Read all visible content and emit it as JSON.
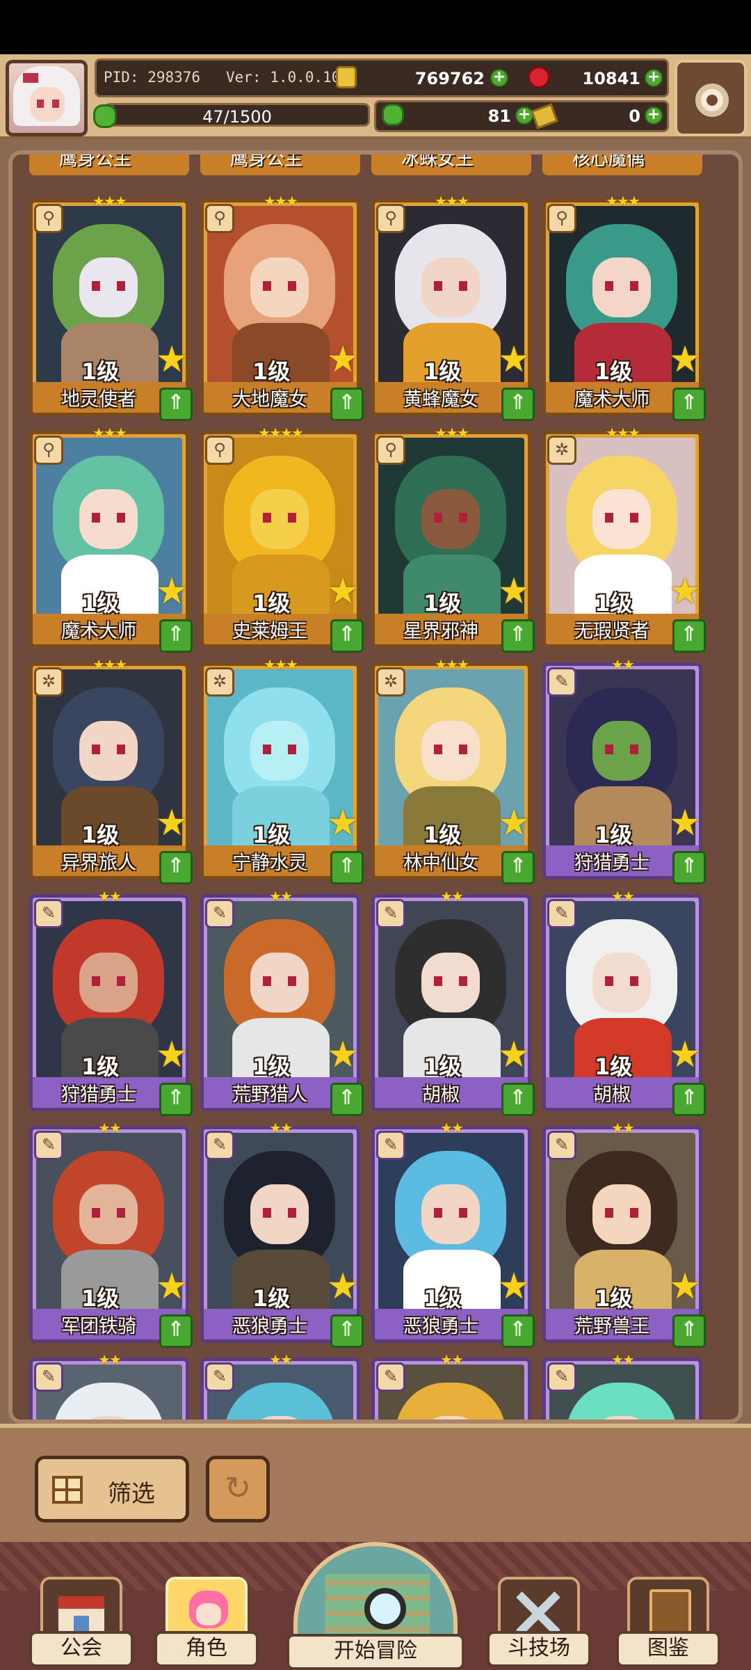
{
  "header": {
    "pid": "PID: 298376",
    "version": "Ver: 1.0.0.10",
    "gold": "769762",
    "gems": "10841",
    "xp_text": "47/1500",
    "xp_fraction": 0.0313,
    "clover": "81",
    "tickets": "0"
  },
  "partial_top": [
    "鹰身公主",
    "鹰身公主",
    "冰蛛女王",
    "核心魔偶"
  ],
  "cards": [
    {
      "name": "地灵使者",
      "level": "1级",
      "rarity": "gold",
      "stars": "★★★",
      "type_icon": "sword",
      "palette": [
        "#2d3a4a",
        "#6aa34a",
        "#e9e6ef",
        "#a98468"
      ]
    },
    {
      "name": "大地魔女",
      "level": "1级",
      "rarity": "gold",
      "stars": "★★★",
      "type_icon": "sword",
      "palette": [
        "#b5502e",
        "#e7a27a",
        "#f3d6bd",
        "#8a4a2a"
      ]
    },
    {
      "name": "黄蜂魔女",
      "level": "1级",
      "rarity": "gold",
      "stars": "★★★",
      "type_icon": "sword",
      "palette": [
        "#2b2b33",
        "#e7e4ec",
        "#f1d5c7",
        "#e3a02c"
      ]
    },
    {
      "name": "魔术大师",
      "level": "1级",
      "rarity": "gold",
      "stars": "★★★",
      "type_icon": "sword",
      "palette": [
        "#1f2a2e",
        "#3a9a8a",
        "#f3d6c8",
        "#b62b3a"
      ]
    },
    {
      "name": "魔术大师",
      "level": "1级",
      "rarity": "gold",
      "stars": "★★★",
      "type_icon": "sword",
      "palette": [
        "#4d7fa0",
        "#63c2a3",
        "#f6dccc",
        "#ffffff"
      ]
    },
    {
      "name": "史莱姆王",
      "level": "1级",
      "rarity": "gold",
      "stars": "★★★★",
      "type_icon": "sword",
      "palette": [
        "#c88a19",
        "#f0b81e",
        "#f6cf4a",
        "#d79a1e"
      ]
    },
    {
      "name": "星界邪神",
      "level": "1级",
      "rarity": "gold",
      "stars": "★★★",
      "type_icon": "sword",
      "palette": [
        "#1f3a36",
        "#2e6e55",
        "#8a5a3e",
        "#3f8a6a"
      ]
    },
    {
      "name": "无瑕贤者",
      "level": "1级",
      "rarity": "gold",
      "stars": "★★★",
      "type_icon": "shield",
      "palette": [
        "#d9c0c0",
        "#f6d565",
        "#fae3d3",
        "#ffffff"
      ]
    },
    {
      "name": "异界旅人",
      "level": "1级",
      "rarity": "gold",
      "stars": "★★★",
      "type_icon": "shield",
      "palette": [
        "#2e3440",
        "#3a4660",
        "#f1d6c6",
        "#6a4a2a"
      ]
    },
    {
      "name": "宁静水灵",
      "level": "1级",
      "rarity": "gold",
      "stars": "★★★",
      "type_icon": "shield",
      "palette": [
        "#5bb7c5",
        "#8fe0ec",
        "#b7f0f4",
        "#7ad0dc"
      ]
    },
    {
      "name": "林中仙女",
      "level": "1级",
      "rarity": "gold",
      "stars": "★★★",
      "type_icon": "shield",
      "palette": [
        "#6aa2b0",
        "#f4d77c",
        "#f8e0cc",
        "#8a7a3a"
      ]
    },
    {
      "name": "狩猎勇士",
      "level": "1级",
      "rarity": "purple",
      "stars": "★★",
      "type_icon": "feather",
      "palette": [
        "#3a3552",
        "#2c2a55",
        "#6aa34a",
        "#b58a5a"
      ]
    },
    {
      "name": "狩猎勇士",
      "level": "1级",
      "rarity": "purple",
      "stars": "★★",
      "type_icon": "feather",
      "palette": [
        "#2e3648",
        "#c0392b",
        "#d9a38a",
        "#4a4a4a"
      ]
    },
    {
      "name": "荒野猎人",
      "level": "1级",
      "rarity": "purple",
      "stars": "★★",
      "type_icon": "feather",
      "palette": [
        "#4c5a60",
        "#c96a2a",
        "#f1d6c6",
        "#e6e6e6"
      ]
    },
    {
      "name": "胡椒",
      "level": "1级",
      "rarity": "purple",
      "stars": "★★",
      "type_icon": "feather",
      "palette": [
        "#404656",
        "#2e2e2e",
        "#f2dccf",
        "#e6e6e6"
      ]
    },
    {
      "name": "胡椒",
      "level": "1级",
      "rarity": "purple",
      "stars": "★★",
      "type_icon": "feather",
      "palette": [
        "#3a4660",
        "#f0f0f0",
        "#f2dccf",
        "#d33a2a"
      ]
    },
    {
      "name": "军团铁骑",
      "level": "1级",
      "rarity": "purple",
      "stars": "★★",
      "type_icon": "feather",
      "palette": [
        "#48505e",
        "#c0452a",
        "#e2b49a",
        "#9a9a9a"
      ]
    },
    {
      "name": "恶狼勇士",
      "level": "1级",
      "rarity": "purple",
      "stars": "★★",
      "type_icon": "feather",
      "palette": [
        "#3e4a5a",
        "#1e222e",
        "#f1d6c6",
        "#5a4a3a"
      ]
    },
    {
      "name": "恶狼勇士",
      "level": "1级",
      "rarity": "purple",
      "stars": "★★",
      "type_icon": "feather",
      "palette": [
        "#2e3e5a",
        "#5bbbe0",
        "#f1d6c6",
        "#ffffff"
      ]
    },
    {
      "name": "荒野兽王",
      "level": "1级",
      "rarity": "purple",
      "stars": "★★",
      "type_icon": "feather",
      "palette": [
        "#6a5a4a",
        "#3e2a20",
        "#f3d6bd",
        "#d9b26a"
      ]
    },
    {
      "name": "",
      "level": "",
      "rarity": "purple",
      "stars": "★★",
      "type_icon": "feather",
      "palette": [
        "#5a6470",
        "#e8eef2",
        "#f1d6c6",
        "#ffffff"
      ]
    },
    {
      "name": "",
      "level": "",
      "rarity": "purple",
      "stars": "★★",
      "type_icon": "feather",
      "palette": [
        "#4a5a6e",
        "#5ac0d8",
        "#f1d6c6",
        "#ffffff"
      ]
    },
    {
      "name": "",
      "level": "",
      "rarity": "purple",
      "stars": "★★",
      "type_icon": "feather",
      "palette": [
        "#5a5040",
        "#e8b03a",
        "#f1d6c6",
        "#ffffff"
      ]
    },
    {
      "name": "",
      "level": "",
      "rarity": "purple",
      "stars": "★★",
      "type_icon": "feather",
      "palette": [
        "#405050",
        "#6ae0c0",
        "#f1d6c6",
        "#ffffff"
      ]
    }
  ],
  "filter": {
    "label": "筛选"
  },
  "nav": {
    "guild": "公会",
    "character": "角色",
    "adventure": "开始冒险",
    "arena": "斗技场",
    "codex": "图鉴"
  },
  "colors": {
    "gold_card": "#e2a23a",
    "purple_card": "#b891e0",
    "upgrade_green": "#49a832",
    "star_yellow": "#f7d21c"
  }
}
